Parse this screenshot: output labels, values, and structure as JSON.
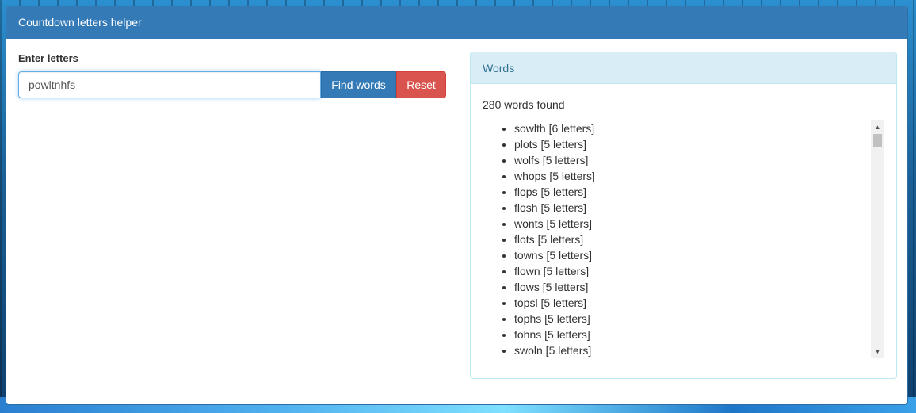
{
  "app": {
    "title": "Countdown letters helper"
  },
  "form": {
    "label": "Enter letters",
    "input_value": "powltnhfs",
    "find_label": "Find words",
    "reset_label": "Reset"
  },
  "words_panel": {
    "title": "Words",
    "count_text": "280 words found",
    "words": [
      "sowlth [6 letters]",
      "plots [5 letters]",
      "wolfs [5 letters]",
      "whops [5 letters]",
      "flops [5 letters]",
      "flosh [5 letters]",
      "wonts [5 letters]",
      "flots [5 letters]",
      "towns [5 letters]",
      "flown [5 letters]",
      "flows [5 letters]",
      "topsl [5 letters]",
      "tophs [5 letters]",
      "fohns [5 letters]",
      "swoln [5 letters]"
    ]
  },
  "scrollbar": {
    "up_icon": "▲",
    "down_icon": "▼"
  },
  "colors": {
    "primary": "#337ab7",
    "danger": "#d9534f",
    "info_bg": "#d9edf7",
    "info_text": "#31708f"
  }
}
